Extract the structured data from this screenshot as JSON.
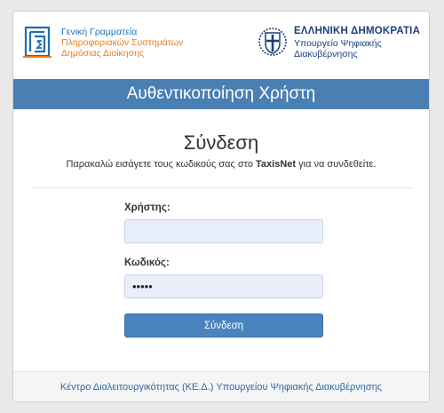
{
  "branding": {
    "gsis": {
      "line1": "Γενική Γραμματεία",
      "line2": "Πληροφοριακών Συστημάτων",
      "line3": "Δημόσιας Διοίκησης",
      "logo_icon": "gsis-logo-icon"
    },
    "government": {
      "line1": "ΕΛΛΗΝΙΚΗ ΔΗΜΟΚΡΑΤΙΑ",
      "line2": "Υπουργείο Ψηφιακής",
      "line3": "Διακυβέρνησης",
      "emblem_icon": "greek-emblem-icon"
    }
  },
  "header": {
    "title": "Αυθεντικοποίηση Χρήστη"
  },
  "login": {
    "title": "Σύνδεση",
    "subtitle_pre": "Παρακαλώ εισάγετε τους κωδικούς σας στο ",
    "subtitle_brand": "TaxisNet",
    "subtitle_post": " για να συνδεθείτε.",
    "username_label": "Χρήστης:",
    "username_value": "",
    "password_label": "Κωδικός:",
    "password_value": "•••••",
    "submit_label": "Σύνδεση"
  },
  "footer": {
    "link_text": "Κέντρο Διαλειτουργικότητας (ΚΕ.Δ.) Υπουργείου Ψηφιακής Διακυβέρνησης"
  },
  "colors": {
    "header_bg": "#4a7fb3",
    "button_bg": "#4a84bf",
    "input_bg": "#e8effa",
    "gsis_blue": "#1f6fb2",
    "gsis_orange": "#e67e22",
    "gov_navy": "#1b3f7a"
  }
}
